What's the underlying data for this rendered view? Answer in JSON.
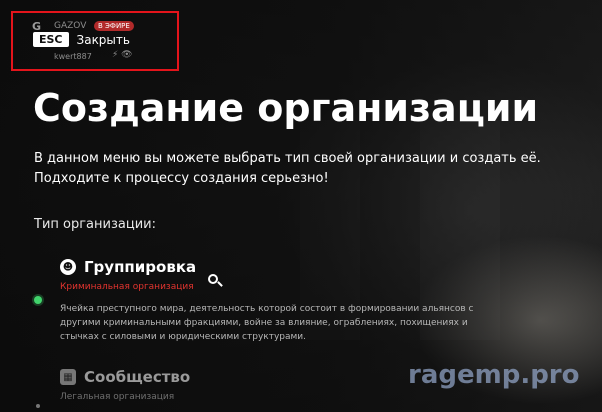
{
  "stream_overlay": {
    "channel_icon": "G",
    "channel_name": "GAZOV",
    "live_badge": "В ЭФИРЕ",
    "username": "kwert887",
    "status_icons": "⚡ 👁"
  },
  "header": {
    "esc_key": "ESC",
    "close_label": "Закрыть"
  },
  "page": {
    "title": "Создание организации",
    "description": "В данном меню вы можете выбрать тип своей организации и создать её. Подходите к процессу создания серьезно!",
    "section_label": "Тип организации:"
  },
  "organizations": [
    {
      "icon": "gang-icon",
      "name": "Группировка",
      "type": "Криминальная организация",
      "description": "Ячейка преступного мира, деятельность которой состоит в формировании альянсов с другими криминальными фракциями, войне за влияние, ограблениях, похищениях и стычках с силовыми и юридическими структурами."
    },
    {
      "icon": "community-icon",
      "name": "Сообщество",
      "type": "Легальная организация"
    }
  ],
  "watermark": "ragemp.pro",
  "colors": {
    "accent_red": "#e2342f",
    "selected_green": "#41d46c",
    "highlight_box": "#e4141b"
  }
}
